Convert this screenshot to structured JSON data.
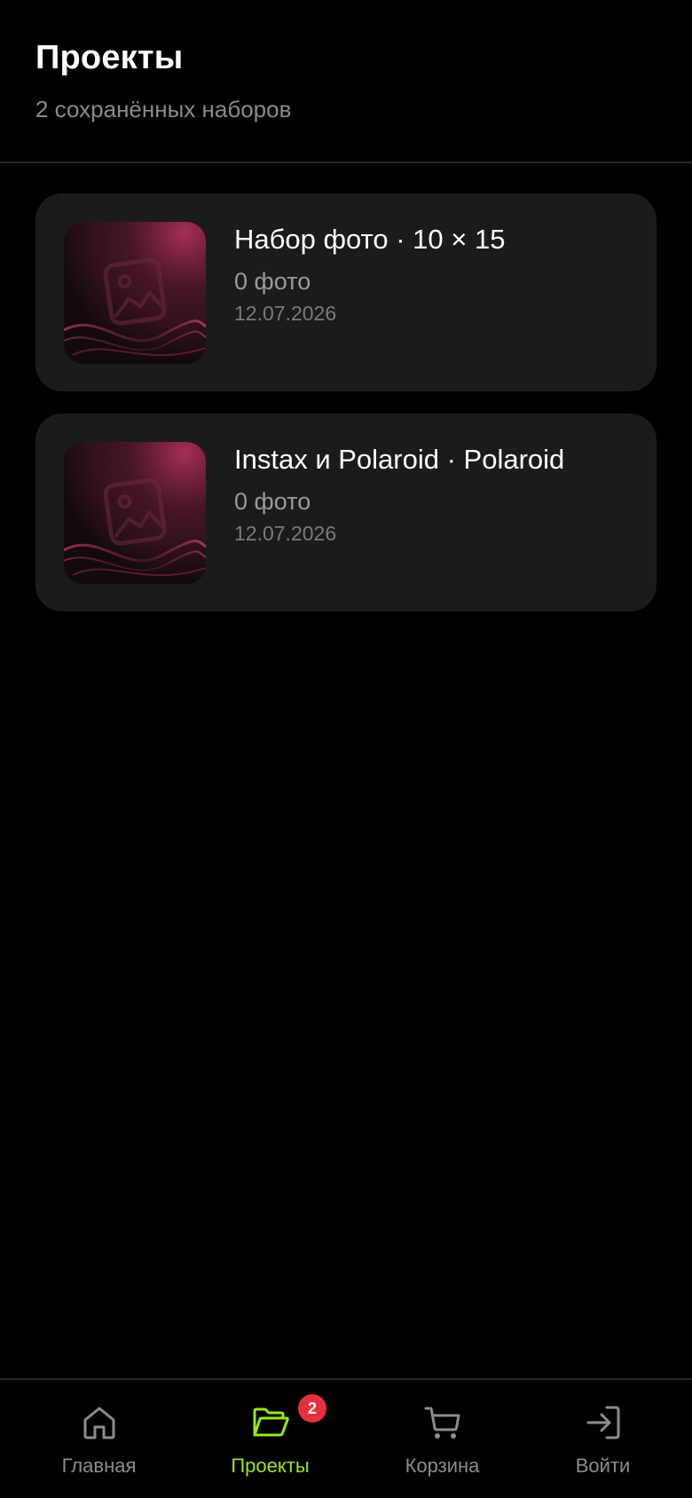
{
  "header": {
    "title": "Проекты",
    "subtitle": "2 сохранённых наборов"
  },
  "projects": [
    {
      "title": "Набор фото · 10 × 15",
      "count": "0 фото",
      "date": "12.07.2026"
    },
    {
      "title": "Instax и Polaroid · Polaroid",
      "count": "0 фото",
      "date": "12.07.2026"
    }
  ],
  "tabbar": {
    "items": [
      {
        "label": "Главная",
        "icon": "home-icon",
        "active": false
      },
      {
        "label": "Проекты",
        "icon": "folder-open-icon",
        "active": true,
        "badge": "2"
      },
      {
        "label": "Корзина",
        "icon": "cart-icon",
        "active": false
      },
      {
        "label": "Войти",
        "icon": "login-icon",
        "active": false
      }
    ]
  },
  "colors": {
    "background": "#000000",
    "card": "#1b1b1b",
    "accent": "#9be61e",
    "badge": "#e8303c",
    "muted_text": "#8a8a8a",
    "thumbnail_tint": "#b0305a"
  }
}
